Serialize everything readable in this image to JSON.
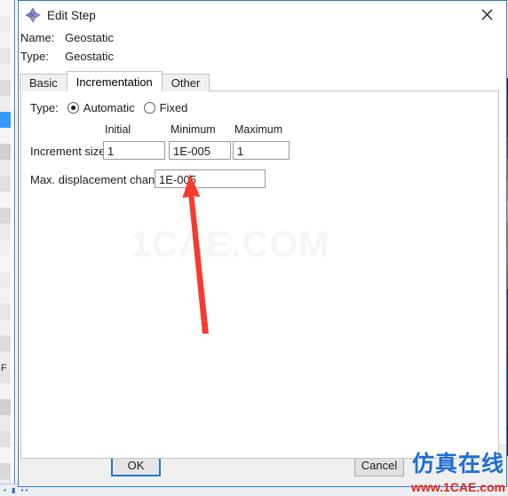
{
  "window": {
    "title": "Edit Step",
    "icon": "abaqus-diamond-icon",
    "close_label": "×",
    "border_color": "#2a7bd4"
  },
  "info": {
    "name_label": "Name:",
    "name_value": "Geostatic",
    "type_label": "Type:",
    "type_value": "Geostatic"
  },
  "tabs": [
    {
      "label": "Basic",
      "active": false
    },
    {
      "label": "Incrementation",
      "active": true
    },
    {
      "label": "Other",
      "active": false
    }
  ],
  "incrementation": {
    "type_label": "Type:",
    "type_options": [
      {
        "label": "Automatic",
        "selected": true
      },
      {
        "label": "Fixed",
        "selected": false
      }
    ],
    "columns": [
      "Initial",
      "Minimum",
      "Maximum"
    ],
    "increment_size_label": "Increment size:",
    "increment_size_values": [
      "1",
      "1E-005",
      "1"
    ],
    "max_disp_label": "Max. displacement change:",
    "max_disp_value": "1E-005"
  },
  "footer": {
    "ok_label": "OK",
    "cancel_label": "Cancel",
    "ok_focus_color": "#1a7ad4"
  },
  "annotation": {
    "arrow_color": "#f93a2f",
    "points_to": "max-displacement-change-input"
  },
  "watermarks": {
    "center": "1CAE.COM",
    "corner_cn": "仿真在线",
    "corner_url": "www.1CAE.com",
    "corner_cn_color": "#1f6fd0",
    "corner_url_color": "#e8241c"
  },
  "background": {
    "frame_letter": "F"
  }
}
